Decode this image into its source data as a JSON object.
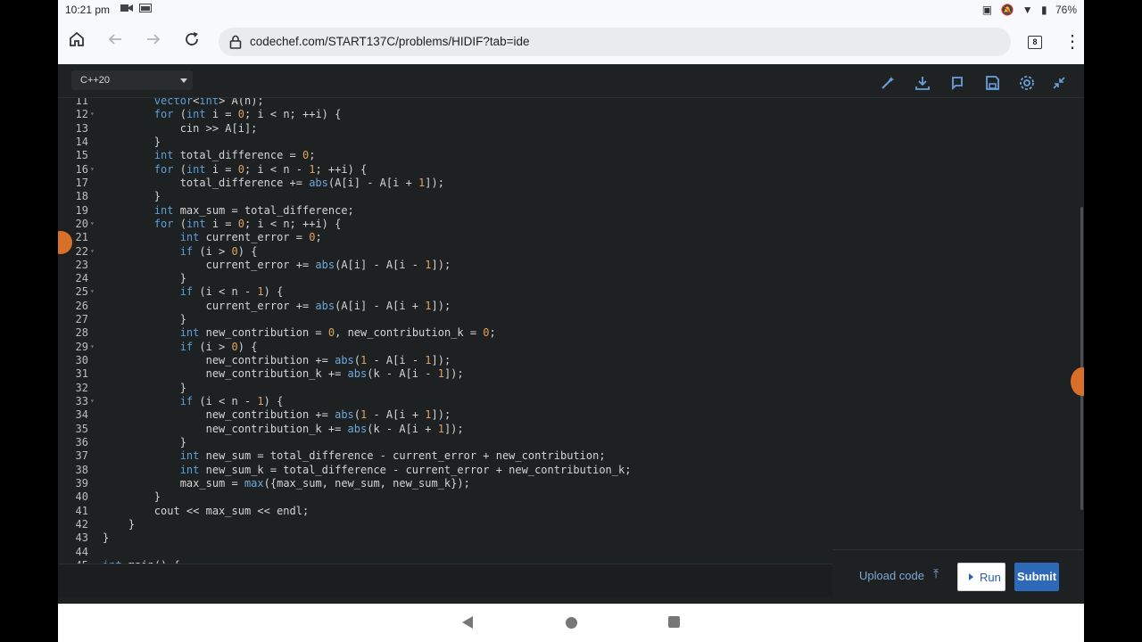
{
  "status_bar": {
    "time": "10:21 pm",
    "battery": "76%"
  },
  "browser": {
    "url": "codechef.com/START137C/problems/HIDIF?tab=ide",
    "tab_count": "8"
  },
  "ide": {
    "language": "C++20",
    "toolbar_icons": [
      "magic-wand-icon",
      "download-icon",
      "reset-icon",
      "save-icon",
      "settings-icon",
      "collapse-icon"
    ],
    "code_lines": [
      {
        "n": "11",
        "text": "        vector<int> A(n);",
        "fold": false
      },
      {
        "n": "12",
        "text": "        for (int i = 0; i < n; ++i) {",
        "fold": true
      },
      {
        "n": "13",
        "text": "            cin >> A[i];",
        "fold": false
      },
      {
        "n": "14",
        "text": "        }",
        "fold": false
      },
      {
        "n": "15",
        "text": "        int total_difference = 0;",
        "fold": false
      },
      {
        "n": "16",
        "text": "        for (int i = 0; i < n - 1; ++i) {",
        "fold": true
      },
      {
        "n": "17",
        "text": "            total_difference += abs(A[i] - A[i + 1]);",
        "fold": false
      },
      {
        "n": "18",
        "text": "        }",
        "fold": false
      },
      {
        "n": "19",
        "text": "        int max_sum = total_difference;",
        "fold": false
      },
      {
        "n": "20",
        "text": "        for (int i = 0; i < n; ++i) {",
        "fold": true
      },
      {
        "n": "21",
        "text": "            int current_error = 0;",
        "fold": false
      },
      {
        "n": "22",
        "text": "            if (i > 0) {",
        "fold": true
      },
      {
        "n": "23",
        "text": "                current_error += abs(A[i] - A[i - 1]);",
        "fold": false
      },
      {
        "n": "24",
        "text": "            }",
        "fold": false
      },
      {
        "n": "25",
        "text": "            if (i < n - 1) {",
        "fold": true
      },
      {
        "n": "26",
        "text": "                current_error += abs(A[i] - A[i + 1]);",
        "fold": false
      },
      {
        "n": "27",
        "text": "            }",
        "fold": false
      },
      {
        "n": "28",
        "text": "            int new_contribution = 0, new_contribution_k = 0;",
        "fold": false
      },
      {
        "n": "29",
        "text": "            if (i > 0) {",
        "fold": true
      },
      {
        "n": "30",
        "text": "                new_contribution += abs(1 - A[i - 1]);",
        "fold": false
      },
      {
        "n": "31",
        "text": "                new_contribution_k += abs(k - A[i - 1]);",
        "fold": false
      },
      {
        "n": "32",
        "text": "            }",
        "fold": false
      },
      {
        "n": "33",
        "text": "            if (i < n - 1) {",
        "fold": true
      },
      {
        "n": "34",
        "text": "                new_contribution += abs(1 - A[i + 1]);",
        "fold": false
      },
      {
        "n": "35",
        "text": "                new_contribution_k += abs(k - A[i + 1]);",
        "fold": false
      },
      {
        "n": "36",
        "text": "            }",
        "fold": false
      },
      {
        "n": "37",
        "text": "            int new_sum = total_difference - current_error + new_contribution;",
        "fold": false
      },
      {
        "n": "38",
        "text": "            int new_sum_k = total_difference - current_error + new_contribution_k;",
        "fold": false
      },
      {
        "n": "39",
        "text": "            max_sum = max({max_sum, new_sum, new_sum_k});",
        "fold": false
      },
      {
        "n": "40",
        "text": "        }",
        "fold": false
      },
      {
        "n": "41",
        "text": "        cout << max_sum << endl;",
        "fold": false
      },
      {
        "n": "42",
        "text": "    }",
        "fold": false
      },
      {
        "n": "43",
        "text": "}",
        "fold": false
      },
      {
        "n": "44",
        "text": "",
        "fold": false
      },
      {
        "n": "45",
        "text": "int main() {",
        "fold": true
      }
    ],
    "upload_label": "Upload code",
    "run_label": "Run",
    "submit_label": "Submit"
  },
  "colors": {
    "editor_bg": "#1e2122",
    "keyword": "#5c9fd6",
    "number": "#e0a060",
    "submit": "#2e68b8"
  }
}
